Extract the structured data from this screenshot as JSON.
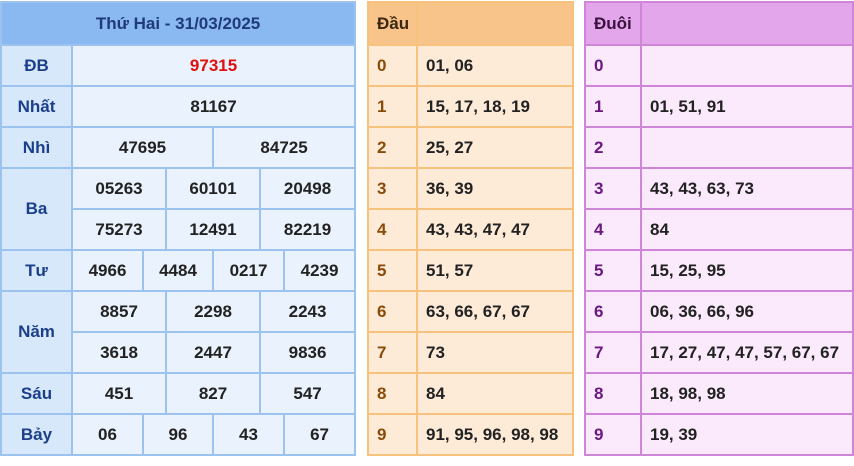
{
  "results": {
    "title": "Thứ Hai - 31/03/2025",
    "db": {
      "label": "ĐB",
      "values": [
        "97315"
      ]
    },
    "nhat": {
      "label": "Nhất",
      "values": [
        "81167"
      ]
    },
    "nhi": {
      "label": "Nhì",
      "values": [
        "47695",
        "84725"
      ]
    },
    "ba": {
      "label": "Ba",
      "row1": [
        "05263",
        "60101",
        "20498"
      ],
      "row2": [
        "75273",
        "12491",
        "82219"
      ]
    },
    "tu": {
      "label": "Tư",
      "values": [
        "4966",
        "4484",
        "0217",
        "4239"
      ]
    },
    "nam": {
      "label": "Năm",
      "row1": [
        "8857",
        "2298",
        "2243"
      ],
      "row2": [
        "3618",
        "2447",
        "9836"
      ]
    },
    "sau": {
      "label": "Sáu",
      "values": [
        "451",
        "827",
        "547"
      ]
    },
    "bay": {
      "label": "Bảy",
      "values": [
        "06",
        "96",
        "43",
        "67"
      ]
    }
  },
  "heads": {
    "header": "Đầu",
    "rows": [
      {
        "digit": "0",
        "values": "01, 06"
      },
      {
        "digit": "1",
        "values": "15, 17, 18, 19"
      },
      {
        "digit": "2",
        "values": "25, 27"
      },
      {
        "digit": "3",
        "values": "36, 39"
      },
      {
        "digit": "4",
        "values": "43, 43, 47, 47"
      },
      {
        "digit": "5",
        "values": "51, 57"
      },
      {
        "digit": "6",
        "values": "63, 66, 67, 67"
      },
      {
        "digit": "7",
        "values": "73"
      },
      {
        "digit": "8",
        "values": "84"
      },
      {
        "digit": "9",
        "values": "91, 95, 96, 98, 98"
      }
    ]
  },
  "tails": {
    "header": "Đuôi",
    "rows": [
      {
        "digit": "0",
        "values": ""
      },
      {
        "digit": "1",
        "values": "01, 51, 91"
      },
      {
        "digit": "2",
        "values": ""
      },
      {
        "digit": "3",
        "values": "43, 43, 63, 73"
      },
      {
        "digit": "4",
        "values": "84"
      },
      {
        "digit": "5",
        "values": "15, 25, 95"
      },
      {
        "digit": "6",
        "values": "06, 36, 66, 96"
      },
      {
        "digit": "7",
        "values": "17, 27, 47, 47, 57, 67, 67"
      },
      {
        "digit": "8",
        "values": "18, 98, 98"
      },
      {
        "digit": "9",
        "values": "19, 39"
      }
    ]
  },
  "colors": {
    "special_prize": "#e01010",
    "results_header": "#8ab8f0",
    "heads_header": "#f9c48a",
    "tails_header": "#e4a6ea"
  }
}
